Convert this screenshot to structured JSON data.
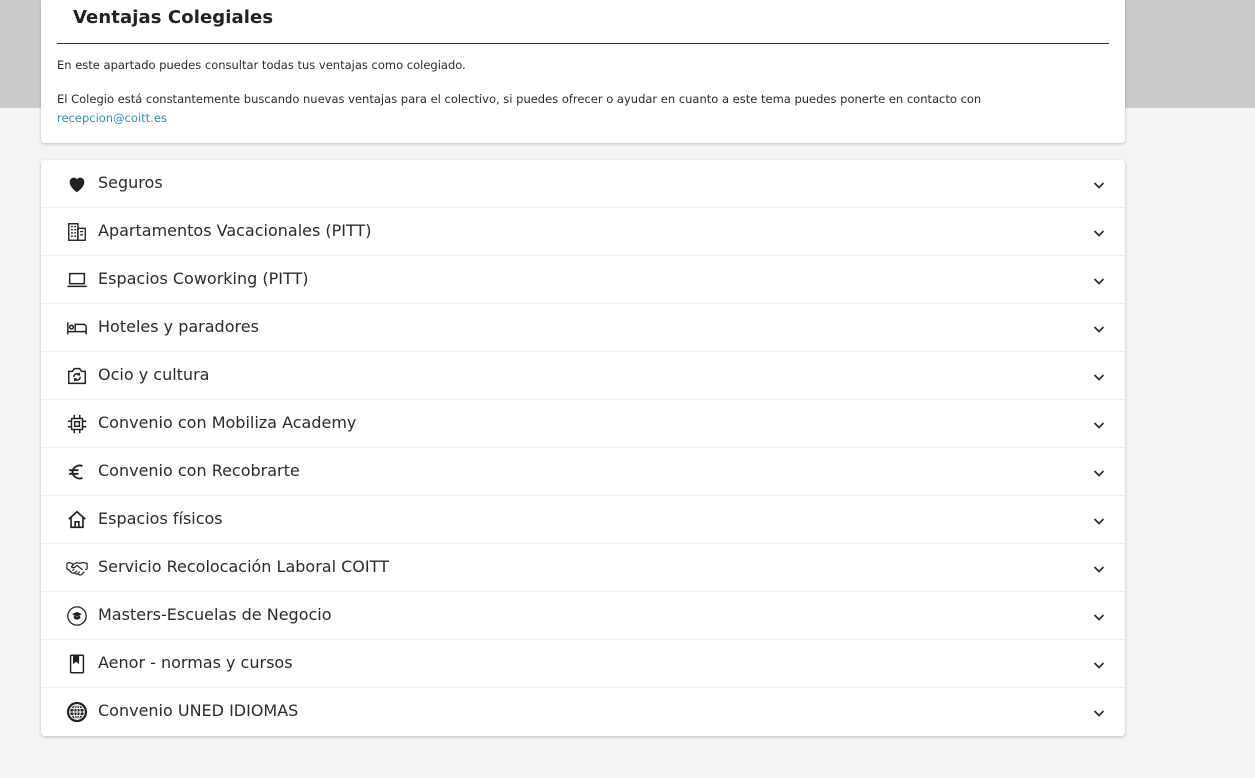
{
  "info": {
    "title": "Ventajas Colegiales",
    "p1": "En este apartado puedes consultar todas tus ventajas como colegiado.",
    "p2": "El Colegio está constantemente buscando nuevas ventajas para el colectivo, si puedes ofrecer o ayudar en cuanto a este tema puedes ponerte en contacto con",
    "email": "recepcion@coitt.es"
  },
  "sections": [
    {
      "label": "Seguros",
      "icon": "heart-icon"
    },
    {
      "label": "Apartamentos Vacacionales (PITT)",
      "icon": "building-icon"
    },
    {
      "label": "Espacios Coworking (PITT)",
      "icon": "laptop-icon"
    },
    {
      "label": "Hoteles y paradores",
      "icon": "bed-icon"
    },
    {
      "label": "Ocio y cultura",
      "icon": "camera-rotate-icon"
    },
    {
      "label": "Convenio con Mobiliza Academy",
      "icon": "chip-icon"
    },
    {
      "label": "Convenio con Recobrarte",
      "icon": "euro-icon"
    },
    {
      "label": "Espacios físicos",
      "icon": "home-icon"
    },
    {
      "label": "Servicio Recolocación Laboral COITT",
      "icon": "handshake-icon"
    },
    {
      "label": "Masters-Escuelas de Negocio",
      "icon": "graduation-icon"
    },
    {
      "label": "Aenor - normas y cursos",
      "icon": "bookmark-book-icon"
    },
    {
      "label": "Convenio UNED IDIOMAS",
      "icon": "globe-icon"
    }
  ],
  "colors": {
    "link": "#2e8fb8",
    "band": "#cbcbcb",
    "background": "#f4f4f4"
  }
}
